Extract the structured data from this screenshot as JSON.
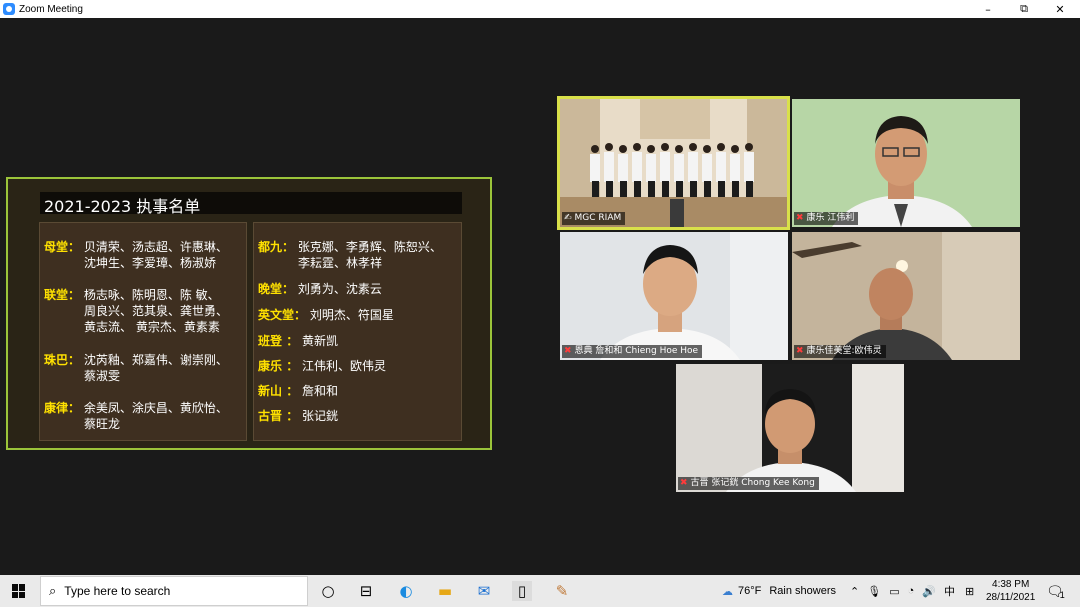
{
  "window": {
    "title": "Zoom Meeting",
    "min": "–",
    "restore": "⧉",
    "close": "✕"
  },
  "slide": {
    "heading": "2021-2023 执事名单",
    "left": [
      {
        "k": "母堂",
        "sep": "：",
        "lines": [
          "贝清荣、汤志超、许惠琳、",
          "沈坤生、李爱璋、杨淑娇"
        ]
      },
      {
        "k": "联堂",
        "sep": "：",
        "lines": [
          "杨志咏、陈明恩、陈 敏、",
          "周良兴、范其泉、龚世勇、",
          "黄志流、 黄宗杰、黄素素"
        ]
      },
      {
        "k": "珠巴",
        "sep": "：",
        "lines": [
          "沈芮釉、郑嘉伟、谢崇刚、",
          "蔡淑雯"
        ]
      },
      {
        "k": "康律",
        "sep": "：",
        "lines": [
          "余美凤、涂庆昌、黄欣怡、",
          "蔡旺龙"
        ]
      }
    ],
    "right": [
      {
        "k": "都九",
        "sep": "：",
        "lines": [
          "张克娜、李勇辉、陈恕兴、",
          "李耘霆、林孝祥"
        ]
      },
      {
        "k": "晚堂",
        "sep": "：",
        "lines": [
          "刘勇为、沈素云"
        ]
      },
      {
        "k": "英文堂",
        "sep": "：",
        "lines": [
          "刘明杰、符国星"
        ]
      },
      {
        "k": "班登",
        "sep": " ：",
        "lines": [
          "黄新凯"
        ]
      },
      {
        "k": "康乐",
        "sep": " ：",
        "lines": [
          "江伟利、欧伟灵"
        ]
      },
      {
        "k": "新山",
        "sep": " ：",
        "lines": [
          "詹和和"
        ]
      },
      {
        "k": "古晋",
        "sep": " ：",
        "lines": [
          "张记銧"
        ]
      }
    ]
  },
  "tiles": [
    {
      "name": "MGC RIAM",
      "muted": false
    },
    {
      "name": "康乐 江伟利",
      "muted": true
    },
    {
      "name": "恩典 詹和和 Chieng Hoe Hoe",
      "muted": true
    },
    {
      "name": "康乐佳美堂:欧伟灵",
      "muted": true
    },
    {
      "name": "古晋 张记銧 Chong Kee Kong",
      "muted": true
    }
  ],
  "taskbar": {
    "search_placeholder": "Type here to search",
    "weather_temp": "76°F",
    "weather_text": "Rain showers",
    "ime": "中",
    "time": "4:38 PM",
    "date": "28/11/2021",
    "notif_count": "1"
  },
  "colors": {
    "active_border": "#d9e04a",
    "slide_border": "#9bc43a",
    "slide_key": "#ffe100"
  }
}
